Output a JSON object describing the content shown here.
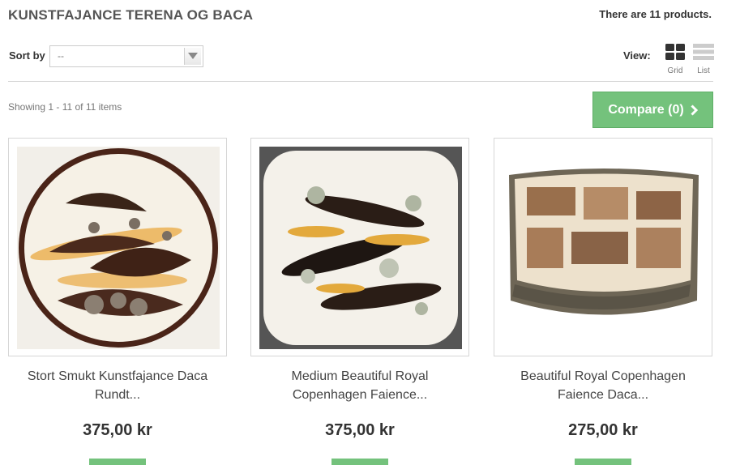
{
  "category": {
    "title": "KUNSTFAJANCE TERENA OG BACA",
    "count_text": "There are 11 products."
  },
  "sort": {
    "label": "Sort by",
    "selected": "--"
  },
  "view": {
    "label": "View:",
    "grid_label": "Grid",
    "list_label": "List"
  },
  "listing": {
    "showing_text": "Showing 1 - 11 of 11 items"
  },
  "compare": {
    "label": "Compare (0)"
  },
  "products": [
    {
      "name": "Stort Smukt Kunstfajance Daca Rundt...",
      "price": "375,00 kr"
    },
    {
      "name": "Medium Beautiful Royal Copenhagen Faience...",
      "price": "375,00 kr"
    },
    {
      "name": "Beautiful Royal Copenhagen Faience Daca...",
      "price": "275,00 kr"
    }
  ],
  "colors": {
    "accent_green": "#74c27c"
  }
}
